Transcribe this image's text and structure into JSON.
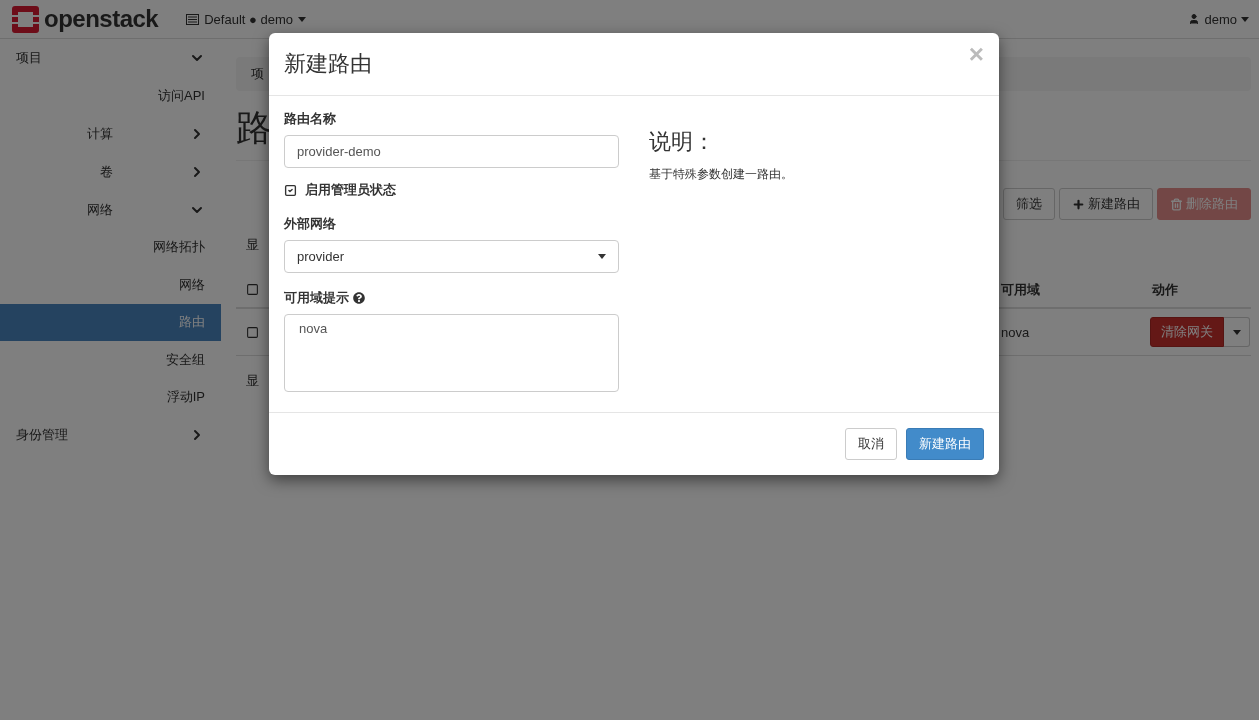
{
  "topbar": {
    "logo": "openstack",
    "project_selector": "Default ● demo",
    "user": "demo"
  },
  "sidebar": {
    "items": [
      {
        "label": "项目",
        "expanded": true,
        "children": [
          {
            "label": "访问API",
            "selected": false
          },
          {
            "label": "计算",
            "expanded": false
          },
          {
            "label": "卷",
            "expanded": false
          },
          {
            "label": "网络",
            "expanded": true,
            "children": [
              {
                "label": "网络拓扑",
                "selected": false
              },
              {
                "label": "网络",
                "selected": false
              },
              {
                "label": "路由",
                "selected": true
              },
              {
                "label": "安全组",
                "selected": false
              },
              {
                "label": "浮动IP",
                "selected": false
              }
            ]
          }
        ]
      },
      {
        "label": "身份管理",
        "expanded": false
      }
    ]
  },
  "breadcrumb": "项",
  "page_title": "路",
  "toolbar": {
    "buttons": [
      {
        "label": "筛选",
        "kind": "default",
        "disabled": false
      },
      {
        "label": "新建路由",
        "kind": "create",
        "disabled": false
      },
      {
        "label": "删除路由",
        "kind": "delete",
        "disabled": true
      }
    ]
  },
  "summary_top": "显",
  "table": {
    "header_checked": false,
    "columns": [
      "可用域",
      "动作"
    ],
    "rows": [
      {
        "checked": false,
        "availability_zone": "nova",
        "action": "清除网关"
      }
    ]
  },
  "summary_bottom": "显",
  "dialog": {
    "title": "新建路由",
    "close": "×",
    "name_field": {
      "label": "路由名称",
      "value": "provider-demo"
    },
    "admin_state": {
      "label": "启用管理员状态",
      "checked": true
    },
    "external_network": {
      "label": "外部网络",
      "value": "provider"
    },
    "az_hints": {
      "label": "可用域提示",
      "value": "nova"
    },
    "help_title": "说明：",
    "help_text": "基于特殊参数创建一路由。",
    "buttons": [
      {
        "label": "取消",
        "kind": "cancel"
      },
      {
        "label": "新建路由",
        "kind": "primary"
      }
    ]
  }
}
